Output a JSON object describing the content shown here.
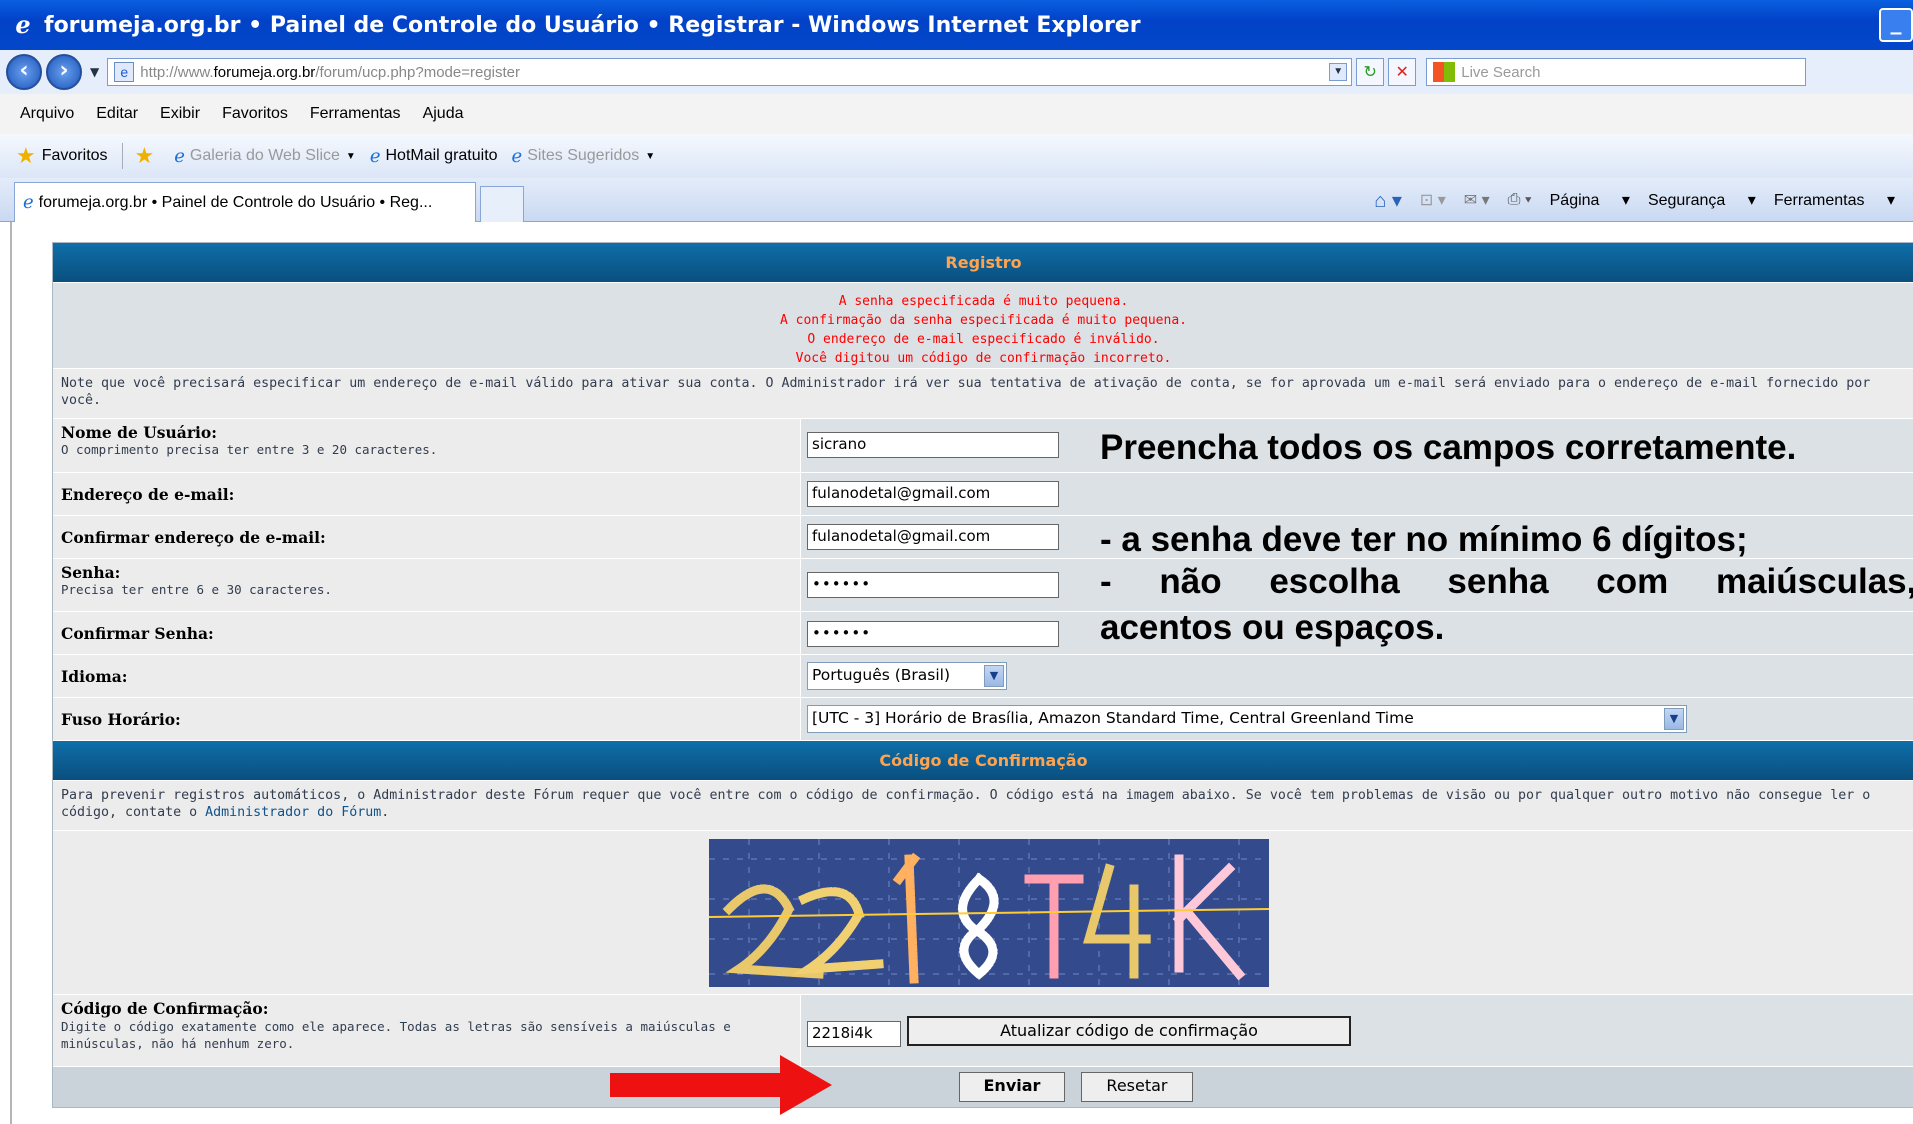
{
  "window": {
    "title": "forumeja.org.br • Painel de Controle do Usuário • Registrar - Windows Internet Explorer"
  },
  "address": {
    "prefix": "http://www.",
    "domain": "forumeja.org.br",
    "path": "/forum/ucp.php?mode=register"
  },
  "search": {
    "placeholder": "Live Search"
  },
  "menu": [
    "Arquivo",
    "Editar",
    "Exibir",
    "Favoritos",
    "Ferramentas",
    "Ajuda"
  ],
  "favorites": {
    "label": "Favoritos",
    "items": [
      "Galeria do Web Slice",
      "HotMail gratuito",
      "Sites Sugeridos"
    ]
  },
  "tab": {
    "label": "forumeja.org.br • Painel de Controle do Usuário • Reg..."
  },
  "commands": [
    "Página",
    "Segurança",
    "Ferramentas"
  ],
  "form": {
    "header": "Registro",
    "errors": [
      "A senha especificada é muito pequena.",
      "A confirmação da senha especificada é muito pequena.",
      "O endereço de e-mail especificado é inválido.",
      "Você digitou um código de confirmação incorreto."
    ],
    "note": "Note que você precisará especificar um endereço de e-mail válido para ativar sua conta. O Administrador irá ver sua tentativa de ativação de conta, se for aprovada um e-mail será enviado para o endereço de e-mail fornecido por você.",
    "fields": {
      "username": {
        "label": "Nome de Usuário:",
        "hint": "O comprimento precisa ter entre 3 e 20 caracteres.",
        "value": "sicrano"
      },
      "email": {
        "label": "Endereço de e-mail:",
        "value": "fulanodetal@gmail.com"
      },
      "email_confirm": {
        "label": "Confirmar endereço de e-mail:",
        "value": "fulanodetal@gmail.com"
      },
      "password": {
        "label": "Senha:",
        "hint": "Precisa ter entre 6 e 30 caracteres.",
        "value": "••••••"
      },
      "password_confirm": {
        "label": "Confirmar Senha:",
        "value": "••••••"
      },
      "language": {
        "label": "Idioma:",
        "value": "Português (Brasil)"
      },
      "timezone": {
        "label": "Fuso Horário:",
        "value": "[UTC - 3] Horário de Brasília, Amazon Standard Time, Central Greenland Time"
      }
    },
    "captcha_header": "Código de Confirmação",
    "captcha_text": "Para prevenir registros automáticos, o Administrador deste Fórum requer que você entre com o código de confirmação. O código está na imagem abaixo. Se você tem problemas de visão ou por qualquer outro motivo não consegue ler o código, contate o ",
    "captcha_link": "Administrador do Fórum",
    "captcha_text_end": ".",
    "captcha_code_label": "Código de Confirmação:",
    "captcha_code_hint": "Digite o código exatamente como ele aparece. Todas as letras são sensíveis a maiúsculas e minúsculas, não há nenhum zero.",
    "captcha_code_value": "2218i4k",
    "refresh_button": "Atualizar código de confirmação",
    "submit_button": "Enviar",
    "reset_button": "Resetar"
  },
  "overlay": {
    "line1": "Preencha todos os campos corretamente.",
    "line2": "- a senha deve ter no mínimo 6 dígitos;",
    "line3": "- não escolha senha com maiúsculas,",
    "line4": "acentos ou espaços."
  },
  "colors": {
    "header_bg": "#0a5a8e",
    "header_text": "#ffa34f",
    "error_text": "#ff0000",
    "arrow": "#ee1111"
  }
}
